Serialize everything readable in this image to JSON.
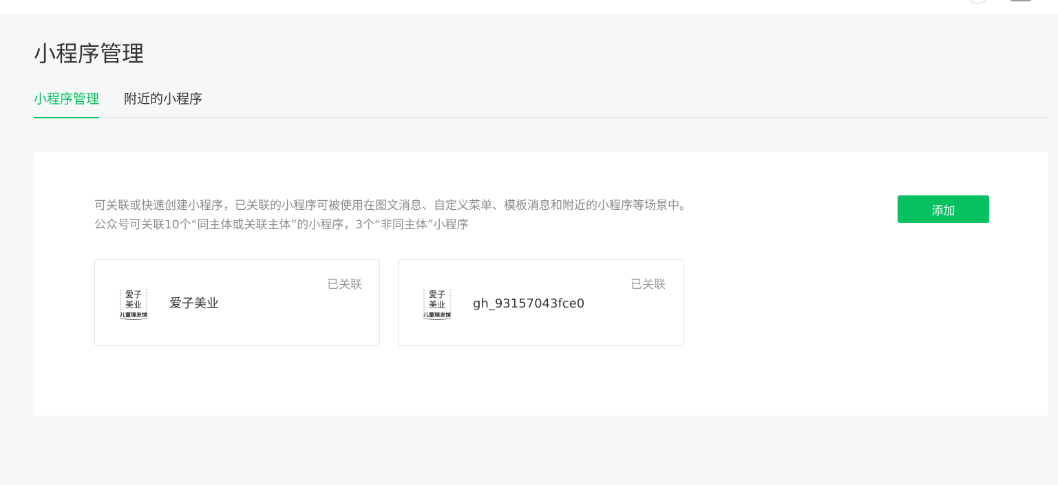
{
  "header": {
    "page_title": "小程序管理"
  },
  "tabs": [
    {
      "label": "小程序管理",
      "active": true
    },
    {
      "label": "附近的小程序",
      "active": false
    }
  ],
  "panel": {
    "description_line1": "可关联或快速创建小程序，已关联的小程序可被使用在图文消息、自定义菜单、模板消息和附近的小程序等场景中。",
    "description_line2": "公众号可关联10个“同主体或关联主体”的小程序，3个“非同主体”小程序",
    "add_button_label": "添加"
  },
  "mini_programs": [
    {
      "name": "爱子美业",
      "status": "已关联",
      "logo": {
        "line1": "愛子",
        "line2": "美业",
        "line3": "儿童理发馆"
      }
    },
    {
      "name": "gh_93157043fce0",
      "status": "已关联",
      "logo": {
        "line1": "愛子",
        "line2": "美业",
        "line3": "儿童理发馆"
      }
    }
  ],
  "colors": {
    "accent": "#07c160",
    "background": "#f6f7f9",
    "muted_text": "#8c8c8c"
  }
}
